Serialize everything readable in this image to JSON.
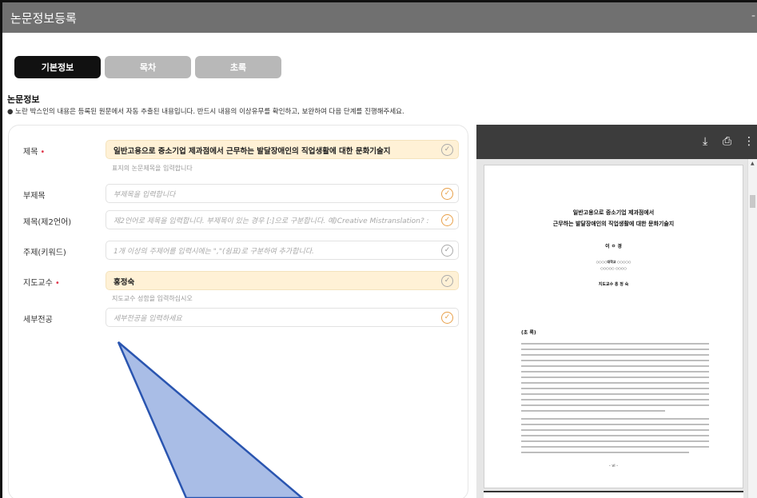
{
  "window": {
    "title": "논문정보등록",
    "close_icon": "close-icon"
  },
  "tabs": [
    {
      "label": "기본정보",
      "active": true
    },
    {
      "label": "목차",
      "active": false
    },
    {
      "label": "초록",
      "active": false
    }
  ],
  "section": {
    "title": "논문정보",
    "notice": "● 노란 박스인의 내용은 등록된 원문에서 자동 추출된 내용입니다. 반드시 내용의 이상유무를 확인하고, 보완하여 다음 단계를 진행해주세요."
  },
  "form": {
    "title": {
      "label": "제목",
      "required": true,
      "value": "일반고용으로 중소기업 제과점에서 근무하는 발달장애인의 직업생활에 대한 문화기술지",
      "hint": "표지의 논문제목을 입력합니다"
    },
    "subtitle": {
      "label": "부제목",
      "placeholder": "부제목을 입력합니다"
    },
    "title_second_lang": {
      "label": "제목(제2언어)",
      "placeholder": "제2언어로 제목을 입력합니다. 부제목이 있는 경우 [:]으로 구분합니다. 예)Creative Mistranslation? : "
    },
    "keywords": {
      "label": "주제(키워드)",
      "placeholder": "1개 이상의 주제어를 입력시에는 \",\"(쉼표)로 구분하여 추가합니다."
    },
    "advisor": {
      "label": "지도교수",
      "required": true,
      "value": "홍정숙",
      "hint": "지도교수 성함을 입력하십시오"
    },
    "major_detail": {
      "label": "세부전공",
      "placeholder": "세부전공을 입력하세요"
    }
  },
  "viewer": {
    "icons": [
      "download-icon",
      "print-icon",
      "more-vert-icon"
    ],
    "document": {
      "title_line1": "일반고용으로 중소기업 제과점에서",
      "title_line2": "근무하는 발달장애인의 직업생활에 대한 문화기술지",
      "author": "이 ㅇ 경",
      "affiliation_line1": "○○○○대학교 ○○○○○",
      "affiliation_line2": "○○○○○ ○○○○",
      "advisor_line": "지도교수 홍 정 숙",
      "abstract_label": "(초 록)",
      "page_number": "- vi -"
    }
  },
  "colors": {
    "titlebar": "#707070",
    "active_tab": "#111111",
    "inactive_tab": "#b8b8b8",
    "filled_field": "#fff1d6",
    "required": "#e0364a",
    "check": "#e8a04a"
  }
}
